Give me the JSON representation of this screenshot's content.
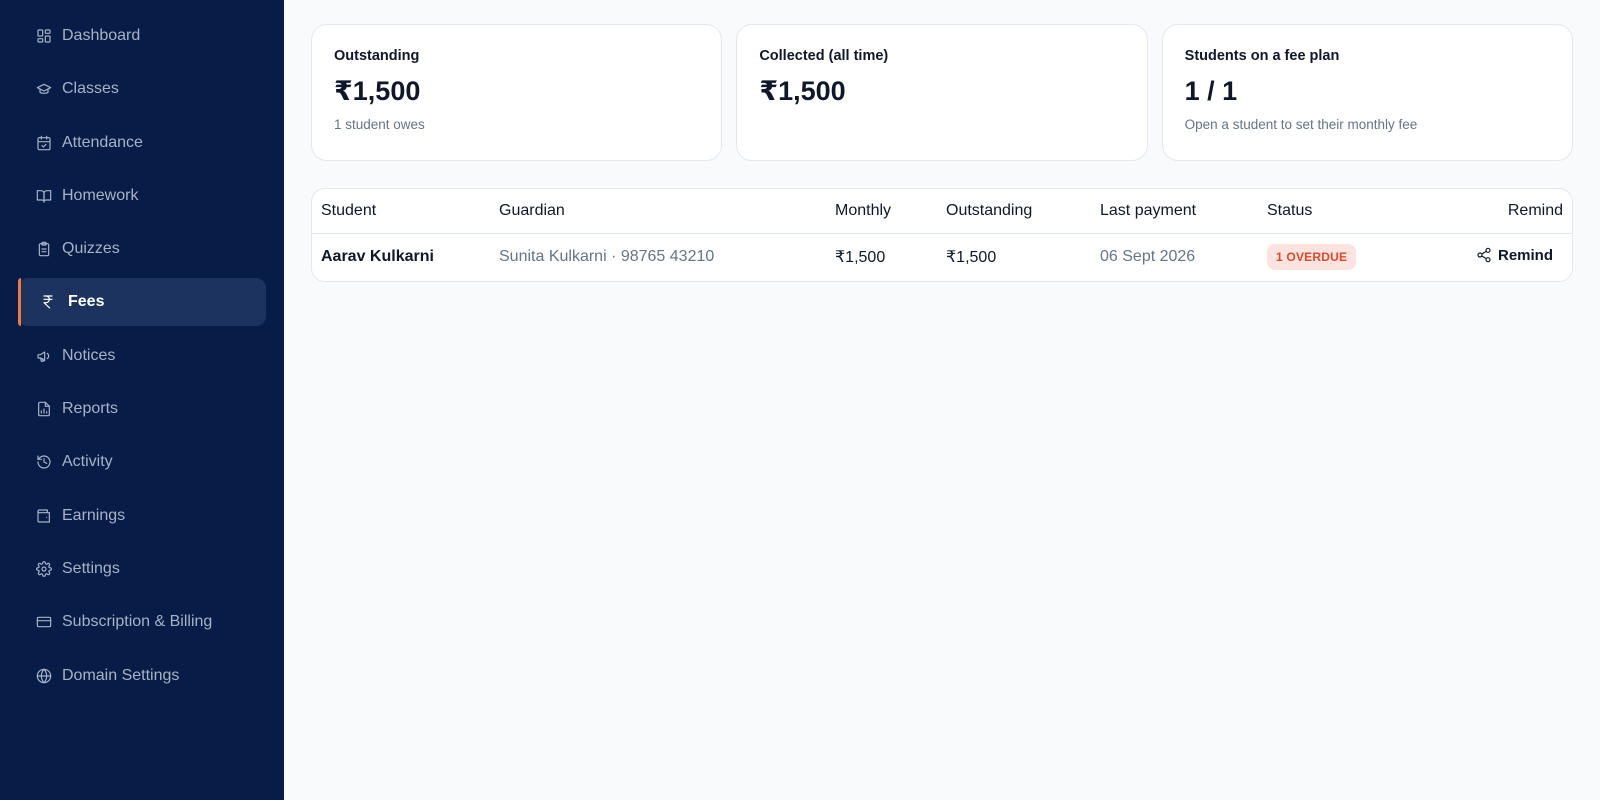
{
  "sidebar": {
    "items": [
      {
        "label": "Dashboard",
        "icon": "dashboard-icon"
      },
      {
        "label": "Classes",
        "icon": "graduation-cap-icon"
      },
      {
        "label": "Attendance",
        "icon": "calendar-check-icon"
      },
      {
        "label": "Homework",
        "icon": "book-open-icon"
      },
      {
        "label": "Quizzes",
        "icon": "clipboard-icon"
      },
      {
        "label": "Fees",
        "icon": "rupee-icon",
        "active": true
      },
      {
        "label": "Notices",
        "icon": "megaphone-icon"
      },
      {
        "label": "Reports",
        "icon": "report-file-icon"
      },
      {
        "label": "Activity",
        "icon": "history-icon"
      },
      {
        "label": "Earnings",
        "icon": "wallet-icon"
      },
      {
        "label": "Settings",
        "icon": "gear-icon"
      },
      {
        "label": "Subscription & Billing",
        "icon": "credit-card-icon"
      },
      {
        "label": "Domain Settings",
        "icon": "globe-icon"
      }
    ],
    "accent_color": "#f07a3e",
    "background_color": "#071d47"
  },
  "cards": [
    {
      "label": "Outstanding",
      "value": "₹1,500",
      "sub": "1 student owes"
    },
    {
      "label": "Collected (all time)",
      "value": "₹1,500",
      "sub": ""
    },
    {
      "label": "Students on a fee plan",
      "value": "1 / 1",
      "sub": "Open a student to set their monthly fee"
    }
  ],
  "table": {
    "headers": {
      "student": "Student",
      "guardian": "Guardian",
      "monthly": "Monthly",
      "outstanding": "Outstanding",
      "last_payment": "Last payment",
      "status": "Status",
      "remind": "Remind"
    },
    "rows": [
      {
        "student": "Aarav Kulkarni",
        "guardian": "Sunita Kulkarni · 98765 43210",
        "monthly": "₹1,500",
        "outstanding": "₹1,500",
        "last_payment": "06 Sept 2026",
        "status": "1 OVERDUE",
        "remind_label": "Remind"
      }
    ]
  }
}
